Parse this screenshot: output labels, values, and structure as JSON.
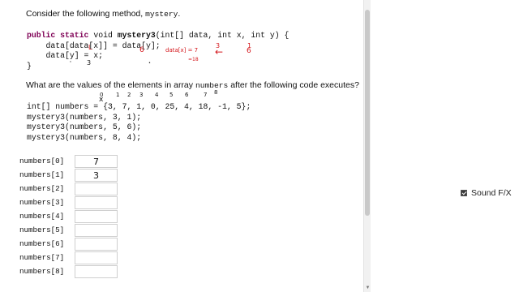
{
  "question": {
    "intro_text": "Consider the following method,",
    "method_name": "mystery",
    "intro_end": ".",
    "code_lines": [
      {
        "kw": "public static",
        "rest_a": " void ",
        "fn": "mystery3",
        "rest_b": "(int[] data, int x, int y) {"
      },
      {
        "text": "    data[data[x]] = data[y];"
      },
      {
        "text": "    data[y] = x;"
      },
      {
        "text": "}"
      }
    ],
    "prompt_before": "What are the values of the elements in array",
    "array_name": "numbers",
    "prompt_after": "after the following code executes?",
    "call_lines": [
      "int[] numbers = {3, 7, 1, 0, 25, 4, 18, -1, 5};",
      "mystery3(numbers, 3, 1);",
      "mystery3(numbers, 5, 6);",
      "mystery3(numbers, 8, 4);"
    ]
  },
  "annotations": {
    "index_marks": [
      "0",
      "1",
      "2",
      "3",
      "4",
      "5",
      "6",
      "7",
      "8"
    ],
    "x_marker": "x",
    "red_letter_l": "L",
    "red_note": "data[x] = 7",
    "red_value": "=18",
    "red_arrow": "←",
    "red_three": "3",
    "red_one": "1",
    "red_six": "6",
    "code_marks": [
      "'",
      "3",
      "•"
    ]
  },
  "answers": [
    {
      "label": "numbers[0]",
      "value": "7"
    },
    {
      "label": "numbers[1]",
      "value": "3"
    },
    {
      "label": "numbers[2]",
      "value": ""
    },
    {
      "label": "numbers[3]",
      "value": ""
    },
    {
      "label": "numbers[4]",
      "value": ""
    },
    {
      "label": "numbers[5]",
      "value": ""
    },
    {
      "label": "numbers[6]",
      "value": ""
    },
    {
      "label": "numbers[7]",
      "value": ""
    },
    {
      "label": "numbers[8]",
      "value": ""
    }
  ],
  "sidebar": {
    "sound_label": "Sound F/X",
    "sound_checked": true
  },
  "colors": {
    "keyword": "#7f0055",
    "ink_red": "#d4161b"
  }
}
